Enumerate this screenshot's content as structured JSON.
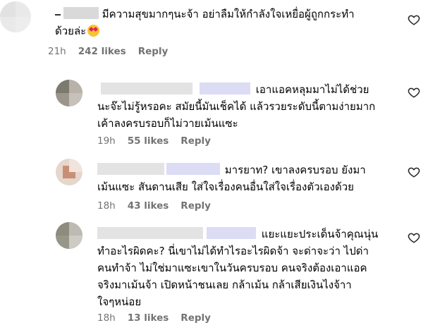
{
  "comments": [
    {
      "username": "",
      "lines": [
        "มีความสุขมากๆนะจ้า อย่าลืมให้กำลังใจเหยื่อผู้ถูกกระทำ",
        "ด้วยล่ะ"
      ],
      "emoji": "smiling-face-with-heart-eyes",
      "time": "21h",
      "likes": "242 likes",
      "reply": "Reply"
    },
    {
      "username": "",
      "lines": [
        "เอาแอคหลุมมาไม่ได้ช่วย",
        "นะจ๊ะไม่รู้หรอคะ สมัยนี้มันเช็คได้ แล้วรวยระดับนี้ตามง่ายมาก",
        "เค้าลงครบรอบก็ไม่วายเม้นแซะ"
      ],
      "time": "19h",
      "likes": "55 likes",
      "reply": "Reply"
    },
    {
      "username": "",
      "lines": [
        "มารยาท? เขาลงครบรอบ ยังมา",
        "เม้นแซะ สันดานเสีย ใส่ใจเรื่องคนอื่นใส่ใจเรื่องตัวเองด้วย"
      ],
      "time": "18h",
      "likes": "43 likes",
      "reply": "Reply"
    },
    {
      "username": "",
      "lines": [
        "แยะแยะประเด็นจ้าคุณนุ่น",
        "ทำอะไรผิดคะ? นี่เขาไม่ได้ทำไรอะไรผิดจ้า จะด่าจะว่า ไปด่า",
        "คนทำจ้า ไม่ใช่มาแซะเขาในวันครบรอบ คนจริงต้องเอาแอค",
        "จริงมาเม้นจ้า เปิดหน้าชนเลย กล้าเม้น กล้าเสียเงินไงจ้าา",
        "ใจๆหน่อย"
      ],
      "time": "18h",
      "likes": "13 likes",
      "reply": "Reply"
    }
  ]
}
